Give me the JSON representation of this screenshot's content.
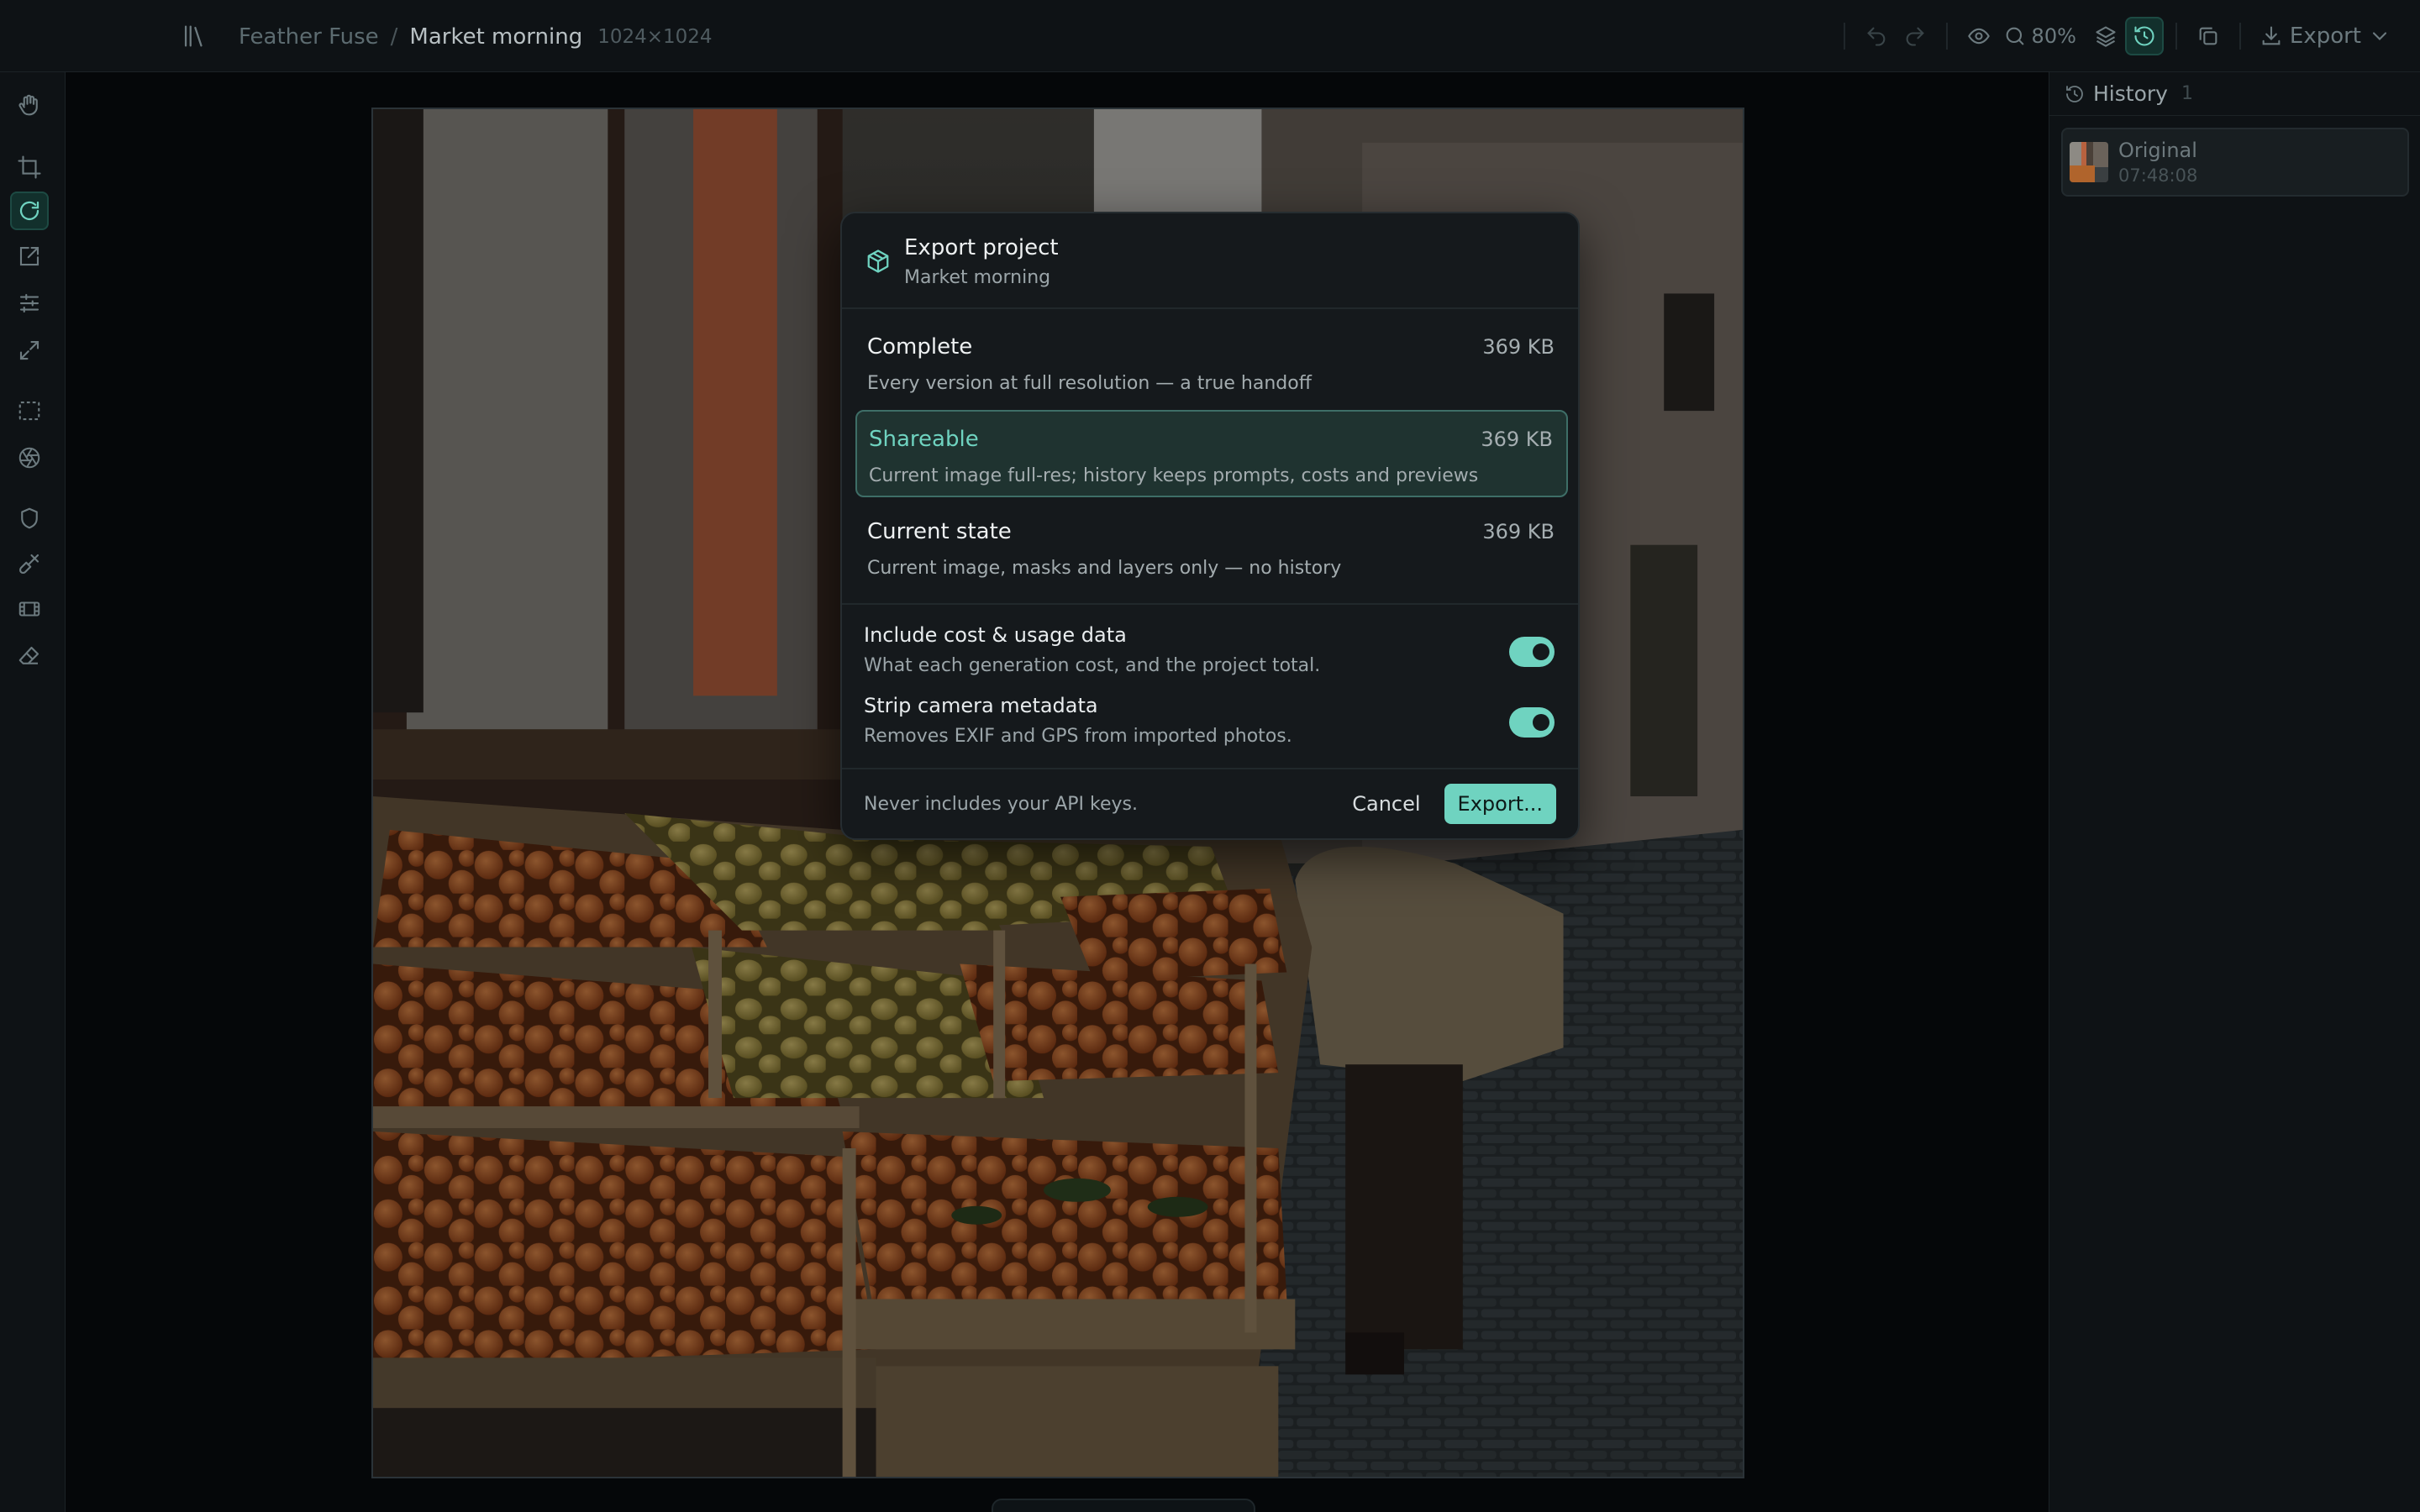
{
  "app": {
    "name": "Feather Fuse",
    "breadcrumb_separator": "/",
    "document_name": "Market morning",
    "document_dims": "1024×1024"
  },
  "toolbar": {
    "zoom": "80%",
    "export_label": "Export",
    "accent": "#6fd3c0"
  },
  "tools": [
    "hand-icon",
    "crop-icon",
    "rotate-icon",
    "edit-external-icon",
    "adjust-sliders-icon",
    "expand-icon",
    "marquee-select-icon",
    "aperture-icon",
    "shield-icon",
    "brush-icon",
    "film-icon",
    "eraser-icon"
  ],
  "history": {
    "title": "History",
    "count": "1",
    "items": [
      {
        "name": "Original",
        "time": "07:48:08"
      }
    ]
  },
  "modal": {
    "title": "Export project",
    "subtitle": "Market morning",
    "options": [
      {
        "name": "Complete",
        "size": "369 KB",
        "desc": "Every version at full resolution — a true handoff",
        "selected": false
      },
      {
        "name": "Shareable",
        "size": "369 KB",
        "desc": "Current image full-res; history keeps prompts, costs and previews",
        "selected": true
      },
      {
        "name": "Current state",
        "size": "369 KB",
        "desc": "Current image, masks and layers only — no history",
        "selected": false
      }
    ],
    "toggles": [
      {
        "label": "Include cost & usage data",
        "desc": "What each generation cost, and the project total.",
        "on": true
      },
      {
        "label": "Strip camera metadata",
        "desc": "Removes EXIF and GPS from imported photos.",
        "on": true
      }
    ],
    "footer_note": "Never includes your API keys.",
    "cancel_label": "Cancel",
    "export_label": "Export..."
  }
}
